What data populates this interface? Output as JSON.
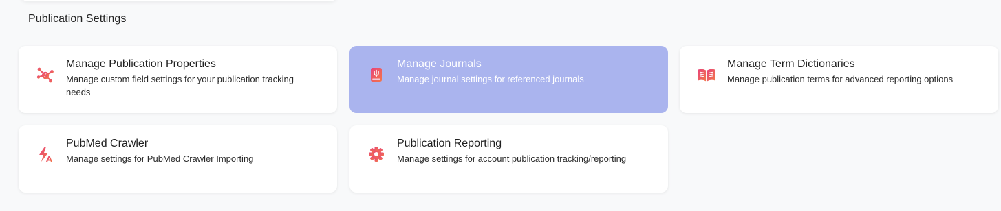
{
  "section": {
    "title": "Publication Settings"
  },
  "cards": [
    {
      "title": "Manage Publication Properties",
      "description": "Manage custom field settings for your publication tracking needs",
      "icon": "network-nodes-icon"
    },
    {
      "title": "Manage Journals",
      "description": "Manage journal settings for referenced journals",
      "icon": "journal-book-icon",
      "active": true
    },
    {
      "title": "Manage Term Dictionaries",
      "description": "Manage publication terms for advanced reporting options",
      "icon": "open-book-icon"
    },
    {
      "title": "PubMed Crawler",
      "description": "Manage settings for PubMed Crawler Importing",
      "icon": "lightning-icon"
    },
    {
      "title": "Publication Reporting",
      "description": "Manage settings for account publication tracking/reporting",
      "icon": "gear-icon"
    }
  ],
  "colors": {
    "accent_gradient_start": "#e8447a",
    "accent_gradient_end": "#f2764a",
    "active_card": "#aab4ee",
    "background": "#f8f9fa"
  }
}
